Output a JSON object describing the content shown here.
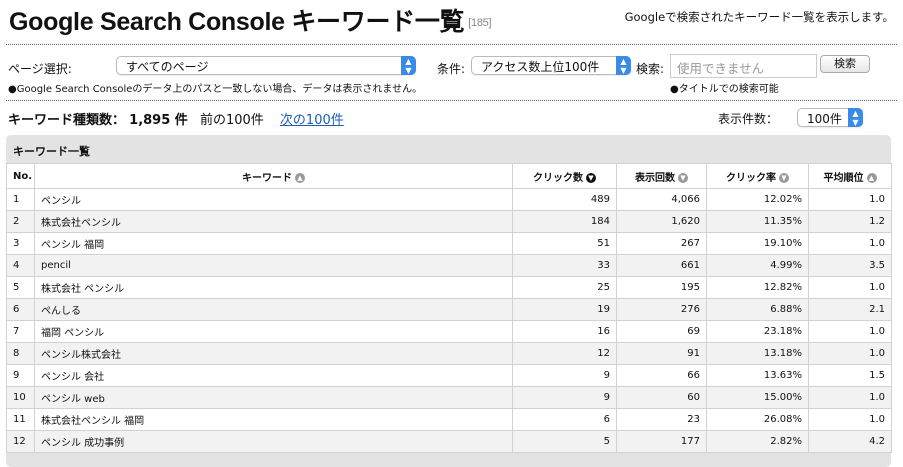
{
  "header": {
    "title": "Google Search Console キーワード一覧",
    "count": "[185]",
    "description": "Googleで検索されたキーワード一覧を表示します。"
  },
  "filters": {
    "page_label": "ページ選択:",
    "page_value": "すべてのページ",
    "condition_label": "条件:",
    "condition_value": "アクセス数上位100件",
    "search_label": "検索:",
    "search_placeholder": "使用できません",
    "search_button": "検索",
    "note_left": "●Google Search Consoleのデータ上のパスと一致しない場合、データは表示されません。",
    "note_right": "●タイトルでの検索可能"
  },
  "summary": {
    "label": "キーワード種類数：",
    "count": "1,895 件",
    "prev": "前の100件",
    "next": "次の100件",
    "per_page_label": "表示件数：",
    "per_page_value": "100件"
  },
  "panel_title": "キーワード一覧",
  "table": {
    "headers": {
      "no": "No.",
      "keyword": "キーワード",
      "clicks": "クリック数",
      "impressions": "表示回数",
      "ctr": "クリック率",
      "position": "平均順位"
    },
    "rows": [
      {
        "no": "1",
        "keyword": "ペンシル",
        "clicks": "489",
        "impressions": "4,066",
        "ctr": "12.02%",
        "position": "1.0"
      },
      {
        "no": "2",
        "keyword": "株式会社ペンシル",
        "clicks": "184",
        "impressions": "1,620",
        "ctr": "11.35%",
        "position": "1.2"
      },
      {
        "no": "3",
        "keyword": "ペンシル 福岡",
        "clicks": "51",
        "impressions": "267",
        "ctr": "19.10%",
        "position": "1.0"
      },
      {
        "no": "4",
        "keyword": "pencil",
        "clicks": "33",
        "impressions": "661",
        "ctr": "4.99%",
        "position": "3.5"
      },
      {
        "no": "5",
        "keyword": "株式会社 ペンシル",
        "clicks": "25",
        "impressions": "195",
        "ctr": "12.82%",
        "position": "1.0"
      },
      {
        "no": "6",
        "keyword": "ぺんしる",
        "clicks": "19",
        "impressions": "276",
        "ctr": "6.88%",
        "position": "2.1"
      },
      {
        "no": "7",
        "keyword": "福岡 ペンシル",
        "clicks": "16",
        "impressions": "69",
        "ctr": "23.18%",
        "position": "1.0"
      },
      {
        "no": "8",
        "keyword": "ペンシル株式会社",
        "clicks": "12",
        "impressions": "91",
        "ctr": "13.18%",
        "position": "1.0"
      },
      {
        "no": "9",
        "keyword": "ペンシル 会社",
        "clicks": "9",
        "impressions": "66",
        "ctr": "13.63%",
        "position": "1.5"
      },
      {
        "no": "10",
        "keyword": "ペンシル web",
        "clicks": "9",
        "impressions": "60",
        "ctr": "15.00%",
        "position": "1.0"
      },
      {
        "no": "11",
        "keyword": "株式会社ペンシル 福岡",
        "clicks": "6",
        "impressions": "23",
        "ctr": "26.08%",
        "position": "1.0"
      },
      {
        "no": "12",
        "keyword": "ペンシル 成功事例",
        "clicks": "5",
        "impressions": "177",
        "ctr": "2.82%",
        "position": "4.2"
      }
    ]
  },
  "colors": {
    "accent": "#3a8be8",
    "link": "#1a5fb4",
    "panel": "#e3e3e3"
  }
}
